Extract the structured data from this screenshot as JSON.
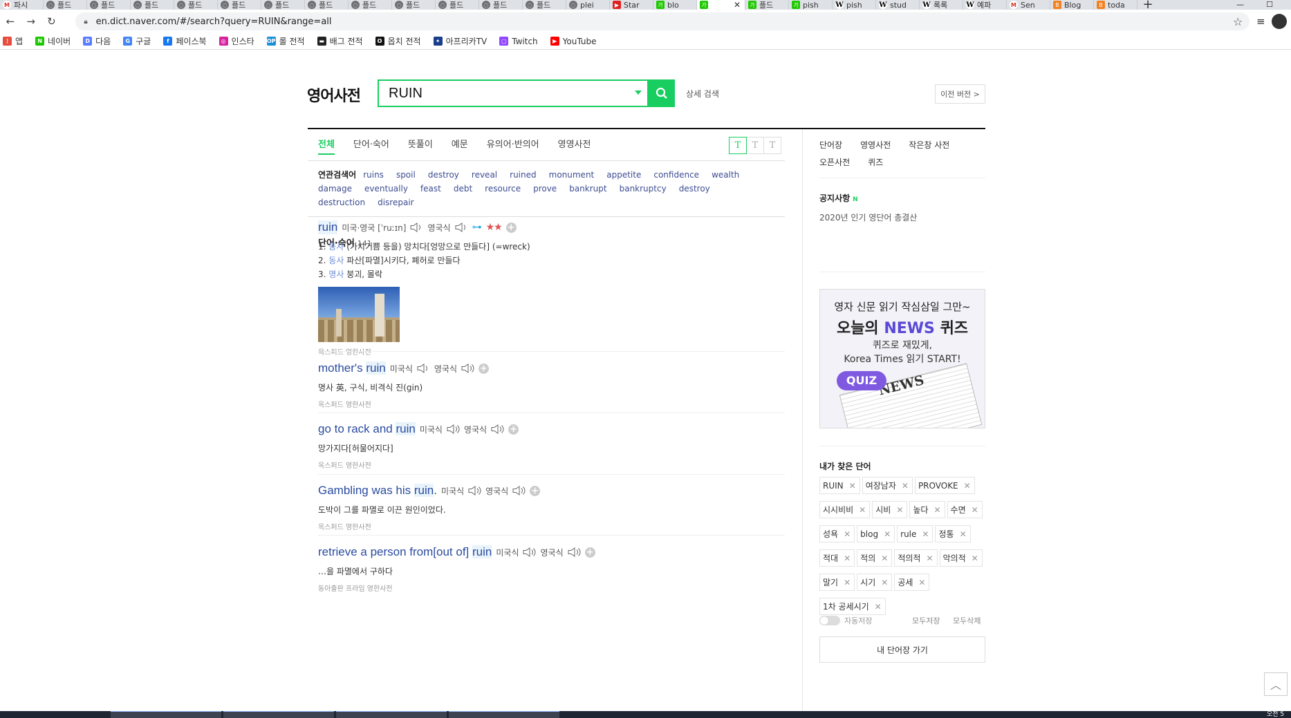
{
  "browser": {
    "tabs": [
      {
        "label": "파시",
        "icon": "gmail"
      },
      {
        "label": "플드",
        "icon": "globe"
      },
      {
        "label": "플드",
        "icon": "globe"
      },
      {
        "label": "플드",
        "icon": "globe"
      },
      {
        "label": "플드",
        "icon": "globe"
      },
      {
        "label": "플드",
        "icon": "globe"
      },
      {
        "label": "플드",
        "icon": "globe"
      },
      {
        "label": "플드",
        "icon": "globe"
      },
      {
        "label": "플드",
        "icon": "globe"
      },
      {
        "label": "플드",
        "icon": "globe"
      },
      {
        "label": "플드",
        "icon": "globe"
      },
      {
        "label": "플드",
        "icon": "globe"
      },
      {
        "label": "플드",
        "icon": "globe"
      },
      {
        "label": "plei",
        "icon": "globe"
      },
      {
        "label": "Star",
        "icon": "youtube"
      },
      {
        "label": "blo",
        "icon": "naver"
      },
      {
        "label": "",
        "icon": "naver",
        "active": true
      },
      {
        "label": "플드",
        "icon": "naver"
      },
      {
        "label": "pish",
        "icon": "naver"
      },
      {
        "label": "pish",
        "icon": "wiki"
      },
      {
        "label": "stud",
        "icon": "wiki"
      },
      {
        "label": "록록",
        "icon": "wiki"
      },
      {
        "label": "예파",
        "icon": "wiki"
      },
      {
        "label": "Sen",
        "icon": "gmail"
      },
      {
        "label": "Blog",
        "icon": "blogger"
      },
      {
        "label": "toda",
        "icon": "blogger"
      }
    ],
    "url": "en.dict.naver.com/#/search?query=RUIN&range=all",
    "bookmarks": [
      {
        "label": "앱",
        "color": "#e74c3c",
        "glyph": "⋮"
      },
      {
        "label": "네이버",
        "color": "#1ec800",
        "glyph": "N"
      },
      {
        "label": "다음",
        "color": "#5a7dff",
        "glyph": "D"
      },
      {
        "label": "구글",
        "color": "#4285f4",
        "glyph": "G"
      },
      {
        "label": "페이스북",
        "color": "#1877f2",
        "glyph": "f"
      },
      {
        "label": "인스타",
        "color": "#d6249f",
        "glyph": "◎"
      },
      {
        "label": "롤 전적",
        "color": "#1a8fd8",
        "glyph": "OP"
      },
      {
        "label": "배그 전적",
        "color": "#222222",
        "glyph": "▬"
      },
      {
        "label": "옵치 전적",
        "color": "#111111",
        "glyph": "O"
      },
      {
        "label": "아프리카TV",
        "color": "#1a3e8a",
        "glyph": "✦"
      },
      {
        "label": "Twitch",
        "color": "#9146ff",
        "glyph": "▢"
      },
      {
        "label": "YouTube",
        "color": "#ff0000",
        "glyph": "▶"
      }
    ]
  },
  "header": {
    "logo": "영어사전",
    "search_value": "RUIN",
    "advanced_search": "상세 검색",
    "prev_version": "이전 버전 >"
  },
  "tabs": [
    "전체",
    "단어·숙어",
    "뜻풀이",
    "예문",
    "유의어·반의어",
    "영영사전"
  ],
  "font_buttons": [
    "T",
    "T",
    "T"
  ],
  "related": {
    "title": "연관검색어",
    "terms": [
      "ruins",
      "spoil",
      "destroy",
      "reveal",
      "ruined",
      "monument",
      "appetite",
      "confidence",
      "wealth",
      "damage",
      "eventually",
      "feast",
      "debt",
      "resource",
      "prove",
      "bankrupt",
      "bankruptcy",
      "destroy",
      "destruction",
      "disrepair"
    ]
  },
  "section": {
    "title": "단어·숙어",
    "count": "141"
  },
  "entries": {
    "ruin": {
      "word": "ruin",
      "pron_us_uk": "미국·영국 [ˈruːɪn]",
      "pron_uk": "영국식",
      "defs": [
        {
          "num": "1.",
          "pos": "동사",
          "text": "(가치기쁨 등을) 망치다[엉망으로 만들다] (=wreck)"
        },
        {
          "num": "2.",
          "pos": "동사",
          "text": "파산[파멸]시키다, 폐허로 만들다"
        },
        {
          "num": "3.",
          "pos": "명사",
          "text": "붕괴, 몰락"
        }
      ],
      "source": "옥스퍼드 영한사전"
    },
    "mothers": {
      "prefix": "mother's ",
      "word": "ruin",
      "pron_us": "미국식",
      "pron_uk": "영국식",
      "def": "명사 英, 구식, 비격식  진(gin)",
      "source": "옥스퍼드 영한사전"
    },
    "rack": {
      "prefix": "go to rack and ",
      "word": "ruin",
      "pron_us": "미국식",
      "pron_uk": "영국식",
      "def": "망가지다[허물어지다]",
      "source": "옥스퍼드 영한사전"
    },
    "gambling": {
      "prefix": "Gambling was his ",
      "word": "ruin",
      "suffix": ".",
      "pron_us": "미국식",
      "pron_uk": "영국식",
      "def": "도박이 그를 파멸로 이끈 원인이었다.",
      "source": "옥스퍼드 영한사전"
    },
    "retrieve": {
      "prefix": "retrieve a person from[out of] ",
      "word": "ruin",
      "pron_us": "미국식",
      "pron_uk": "영국식",
      "def": "…을 파멸에서 구하다",
      "source": "동아출판 프라임 영한사전"
    }
  },
  "sidebar": {
    "links": [
      "단어장",
      "영영사전",
      "작은창 사전",
      "오픈사전",
      "퀴즈"
    ],
    "notice_title": "공지사항",
    "notice_new": "N",
    "notice_item": "2020년 인기 영단어 총결산",
    "ad": {
      "line1": "영자 신문 읽기 작심삼일 그만~",
      "line2_pre": "오늘의 ",
      "line2_news": "NEWS",
      "line2_post": " 퀴즈",
      "line3": "퀴즈로 재밌게,",
      "line4": "Korea Times 읽기 START!",
      "quiz": "QUIZ",
      "paper": "NEWS"
    },
    "my_words_title": "내가 찾은 단어",
    "my_words": [
      "RUIN",
      "여장남자",
      "PROVOKE",
      "시시비비",
      "시비",
      "높다",
      "수면",
      "성욕",
      "blog",
      "rule",
      "정통",
      "적대",
      "적의",
      "적의적",
      "악의적",
      "말기",
      "시기",
      "공세",
      "1차 공세시기"
    ],
    "auto_save": "자동저장",
    "save_all": "모두저장",
    "delete_all": "모두삭제",
    "goto_wordbook": "내 단어장 가기"
  },
  "taskbar": {
    "clock": "오전 5"
  }
}
